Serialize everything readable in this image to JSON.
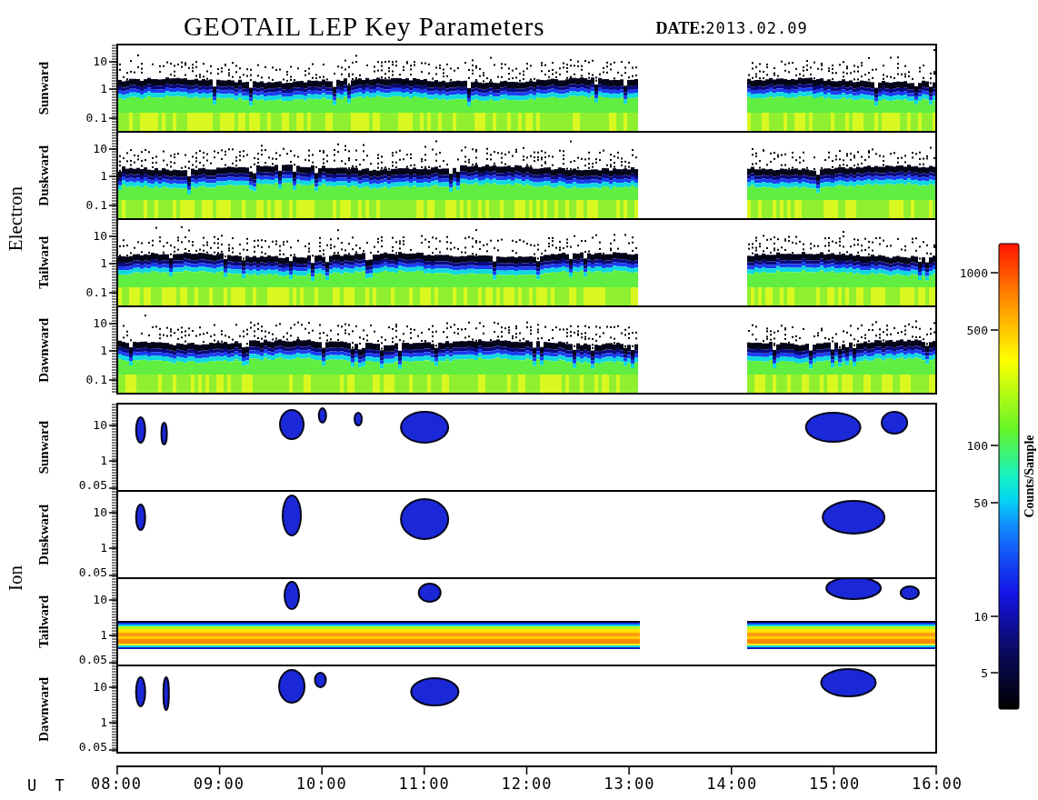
{
  "title": "GEOTAIL LEP Key Parameters",
  "date": {
    "label": "DATE:",
    "value": "2013.02.09"
  },
  "groups": [
    {
      "name": "Electron",
      "panels": [
        {
          "direction": "Sunward",
          "kind": "electron",
          "yticks": [
            "10",
            "1",
            "0.1"
          ]
        },
        {
          "direction": "Duskward",
          "kind": "electron",
          "yticks": [
            "10",
            "1",
            "0.1"
          ]
        },
        {
          "direction": "Tailward",
          "kind": "electron",
          "yticks": [
            "10",
            "1",
            "0.1"
          ]
        },
        {
          "direction": "Dawnward",
          "kind": "electron",
          "yticks": [
            "10",
            "1",
            "0.1"
          ]
        }
      ]
    },
    {
      "name": "Ion",
      "panels": [
        {
          "direction": "Sunward",
          "kind": "ion",
          "yticks": [
            "10",
            "1",
            "0.05"
          ]
        },
        {
          "direction": "Duskward",
          "kind": "ion",
          "yticks": [
            "10",
            "1",
            "0.05"
          ]
        },
        {
          "direction": "Tailward",
          "kind": "ion_beam",
          "yticks": [
            "10",
            "1",
            "0.05"
          ]
        },
        {
          "direction": "Dawnward",
          "kind": "ion",
          "yticks": [
            "10",
            "1",
            "0.05"
          ]
        }
      ]
    }
  ],
  "x_axis": {
    "label": "U T",
    "ticks": [
      "08:00",
      "09:00",
      "10:00",
      "11:00",
      "12:00",
      "13:00",
      "14:00",
      "15:00",
      "16:00"
    ]
  },
  "colorbar": {
    "label": "Counts/Sample",
    "ticks": [
      "1000",
      "500",
      "100",
      "50",
      "10",
      "5"
    ]
  }
}
